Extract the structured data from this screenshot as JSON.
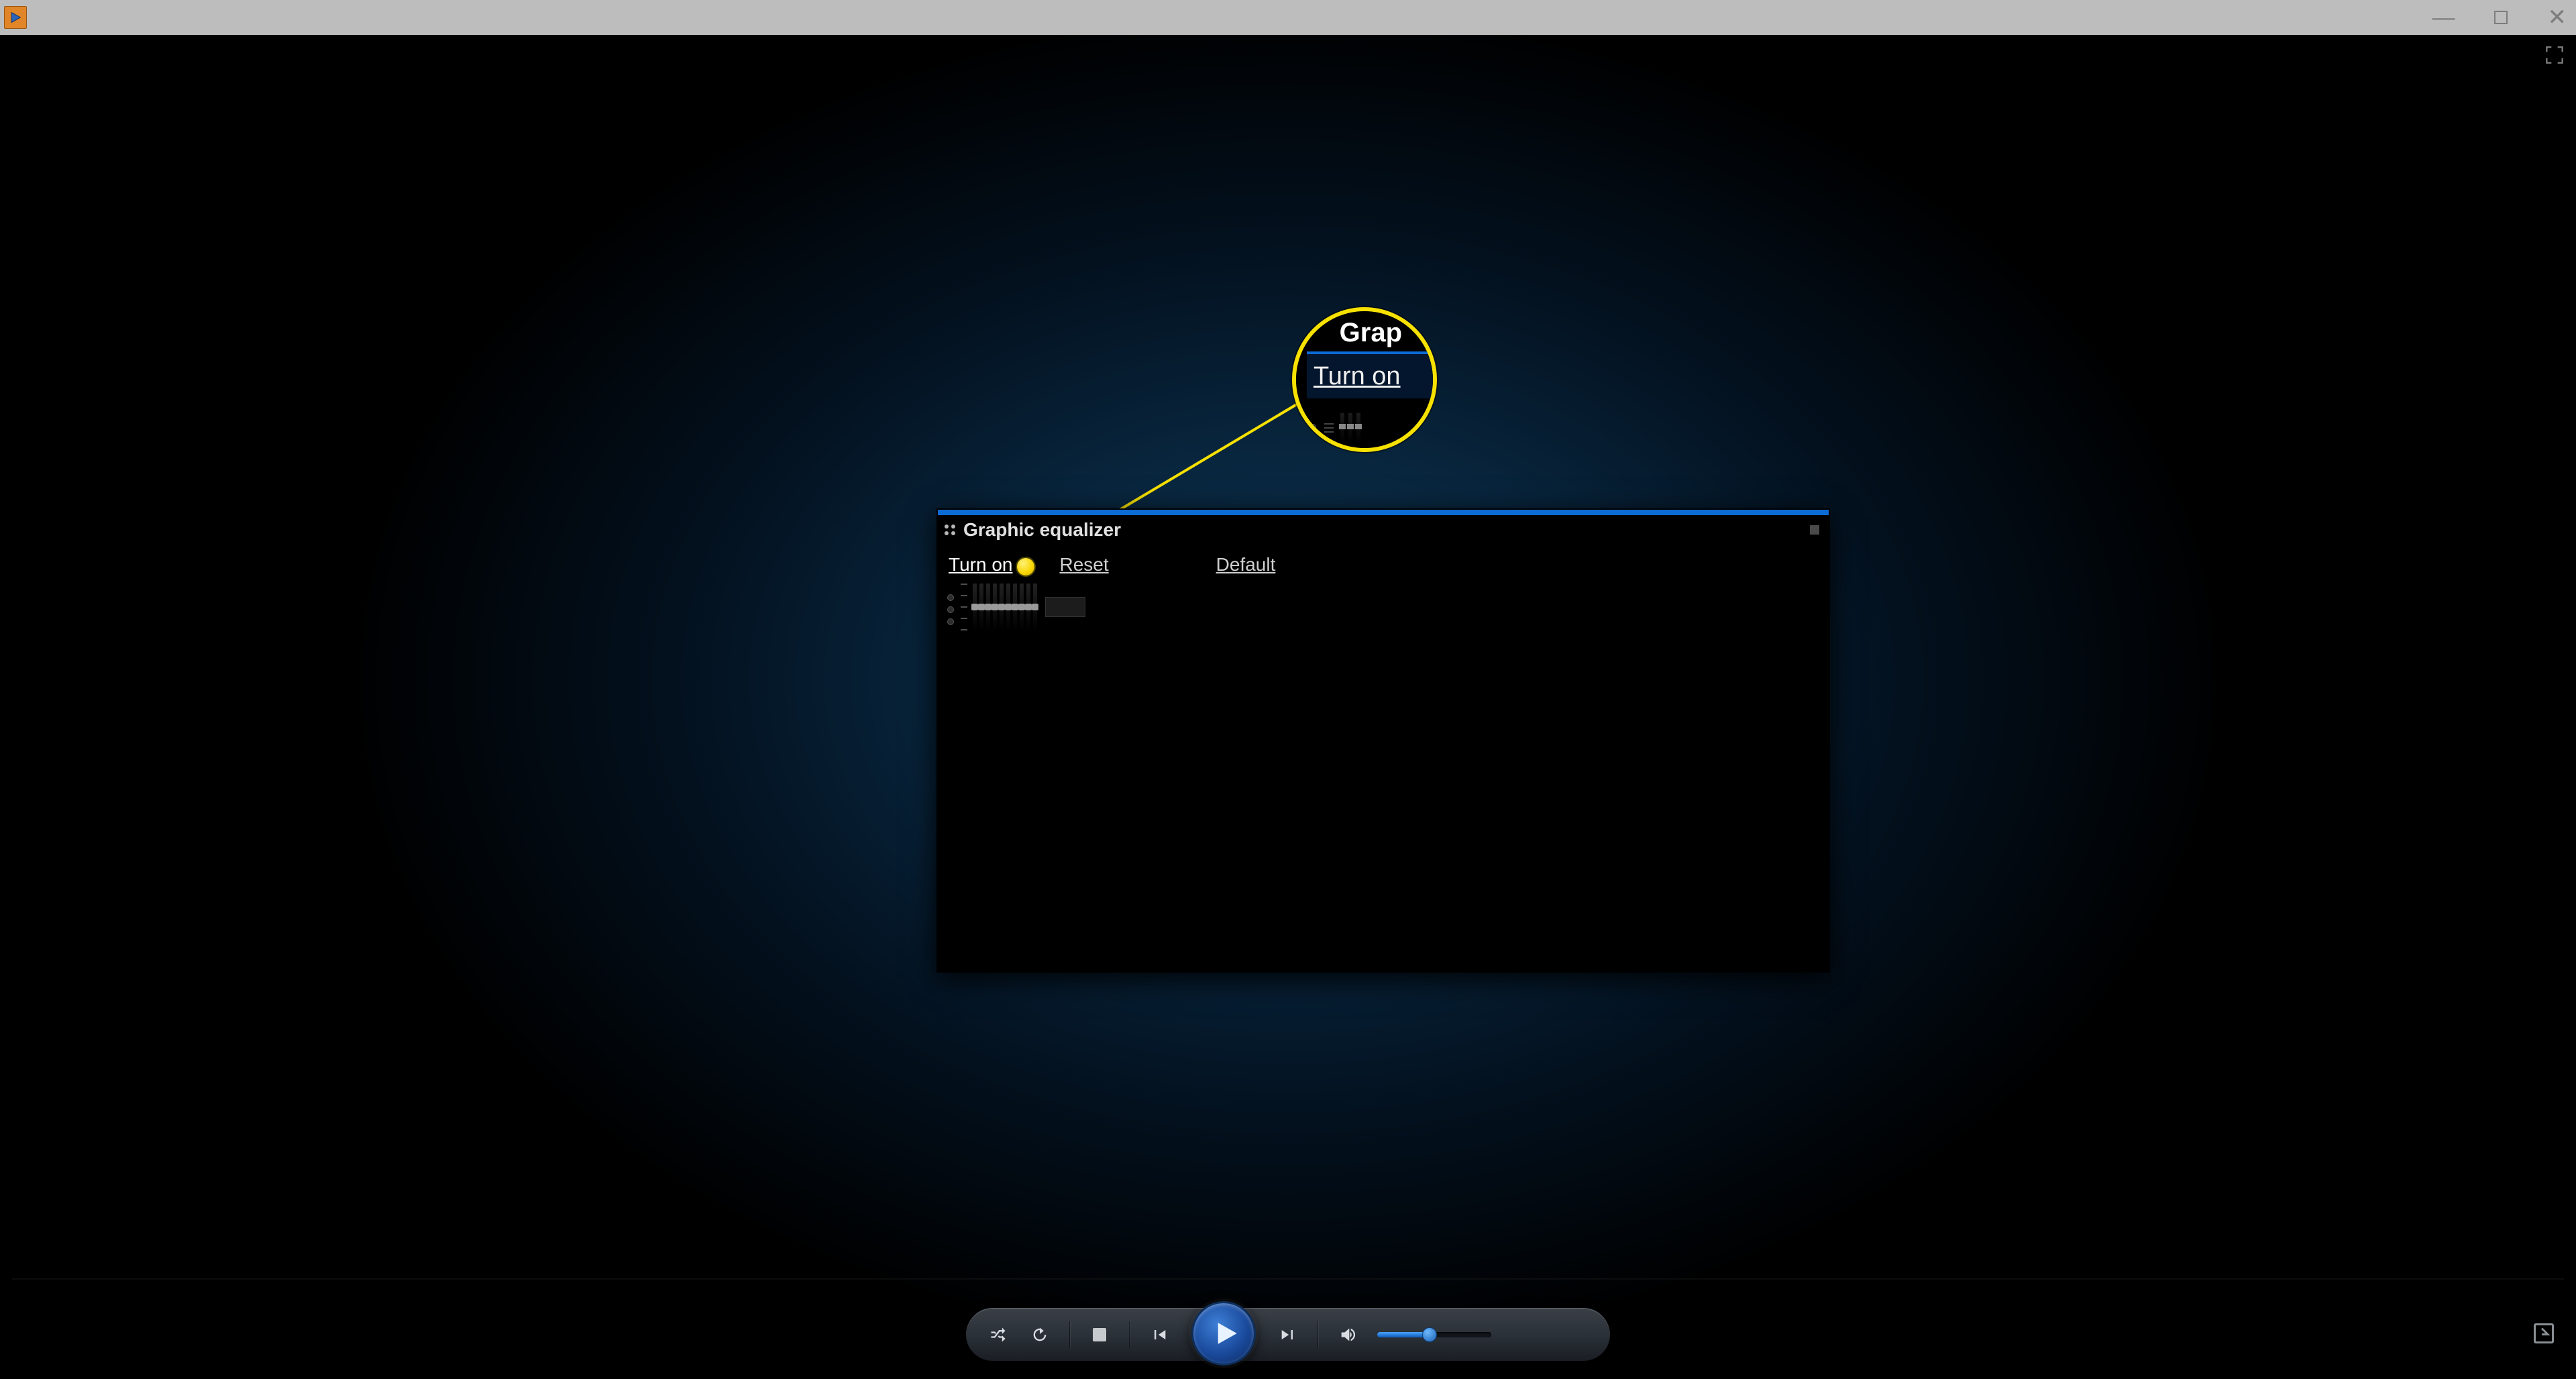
{
  "window": {
    "controls": {
      "minimize": "—",
      "maximize": "",
      "close": "✕"
    }
  },
  "equalizer": {
    "title": "Graphic equalizer",
    "links": {
      "turn_on": "Turn on",
      "reset": "Reset",
      "default": "Default"
    },
    "band_count": 10
  },
  "magnifier": {
    "title_fragment": "Grap",
    "link": "Turn on"
  },
  "controls": {
    "volume_percent": 46
  }
}
